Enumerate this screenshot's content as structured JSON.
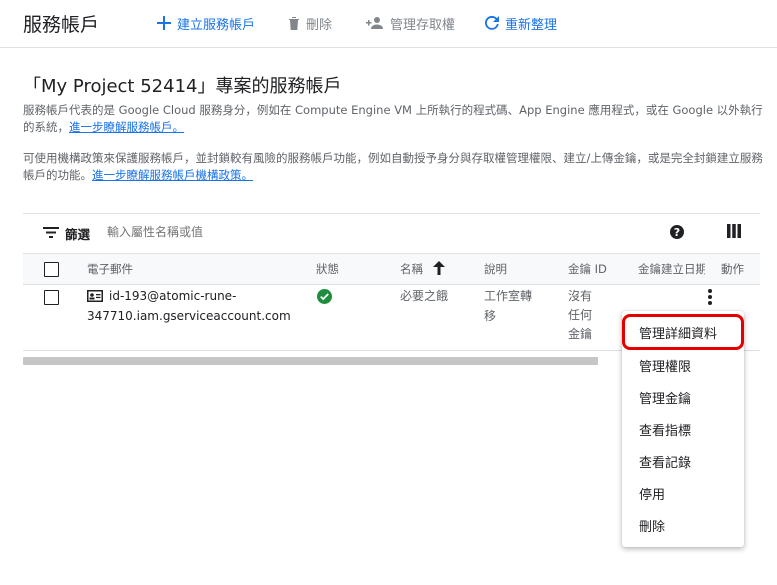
{
  "header": {
    "title": "服務帳戶",
    "create_label": "建立服務帳戶",
    "delete_label": "刪除",
    "manage_access_label": "管理存取權",
    "refresh_label": "重新整理"
  },
  "project_heading": "「My Project 52414」專案的服務帳戶",
  "description": {
    "p1_text": "服務帳戶代表的是 Google Cloud 服務身分，例如在 Compute Engine VM 上所執行的程式碼、App Engine 應用程式，或在 Google 以外執行的系統，",
    "p1_link": "進一步瞭解服務帳戶。",
    "p2_text": "可使用機構政策來保護服務帳戶，並封鎖較有風險的服務帳戶功能，例如自動授予身分與存取權管理權限、建立/上傳金鑰，或是完全封鎖建立服務帳戶的功能。",
    "p2_link": "進一步瞭解服務帳戶機構政策。"
  },
  "filter": {
    "label": "篩選",
    "placeholder": "輸入屬性名稱或值"
  },
  "table": {
    "headers": {
      "email": "電子郵件",
      "status": "狀態",
      "name": "名稱",
      "description": "說明",
      "key_id": "金鑰 ID",
      "key_created": "金鑰建立日期",
      "actions": "動作"
    },
    "rows": [
      {
        "email_line1": "id-193@atomic-rune-",
        "email_line2": "347710.iam.gserviceaccount.com",
        "status": "enabled",
        "name": "必要之餓",
        "desc_line1": "工作室轉",
        "desc_line2": "移",
        "key_line1": "沒有",
        "key_line2": "任何",
        "key_line3": "金鑰",
        "key_created": ""
      }
    ]
  },
  "menu": {
    "items": [
      "管理詳細資料",
      "管理權限",
      "管理金鑰",
      "查看指標",
      "查看記錄",
      "停用",
      "刪除"
    ]
  },
  "colors": {
    "accent": "#1a73e8",
    "success": "#1e8e3e",
    "highlight": "#e50000"
  }
}
